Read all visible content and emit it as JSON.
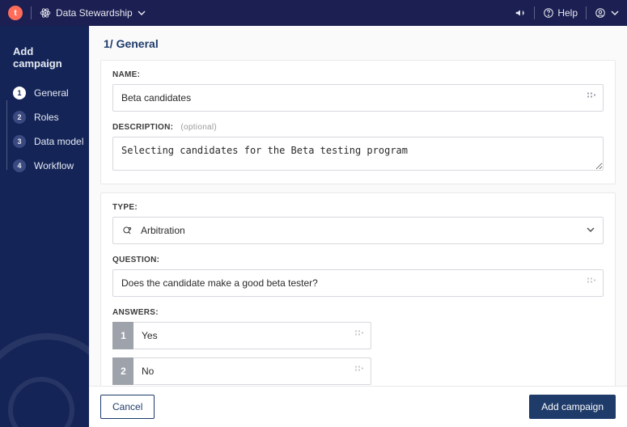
{
  "topbar": {
    "logo_glyph": "t",
    "app_title": "Data Stewardship",
    "help_label": "Help"
  },
  "sidebar": {
    "title": "Add campaign",
    "steps": [
      {
        "num": "1",
        "label": "General",
        "active": true
      },
      {
        "num": "2",
        "label": "Roles"
      },
      {
        "num": "3",
        "label": "Data model"
      },
      {
        "num": "4",
        "label": "Workflow"
      }
    ]
  },
  "page": {
    "section_title": "1/ General",
    "name_label": "NAME:",
    "name_value": "Beta candidates",
    "description_label": "DESCRIPTION:",
    "description_optional": "(optional)",
    "description_value": "Selecting candidates for the Beta testing program",
    "type_label": "TYPE:",
    "type_value": "Arbitration",
    "question_label": "QUESTION:",
    "question_value": "Does the candidate make a good beta tester?",
    "answers_label": "ANSWERS:",
    "answers": [
      {
        "num": "1",
        "value": "Yes"
      },
      {
        "num": "2",
        "value": "No"
      }
    ],
    "add_glyph": "+"
  },
  "footer": {
    "cancel": "Cancel",
    "submit": "Add campaign"
  }
}
